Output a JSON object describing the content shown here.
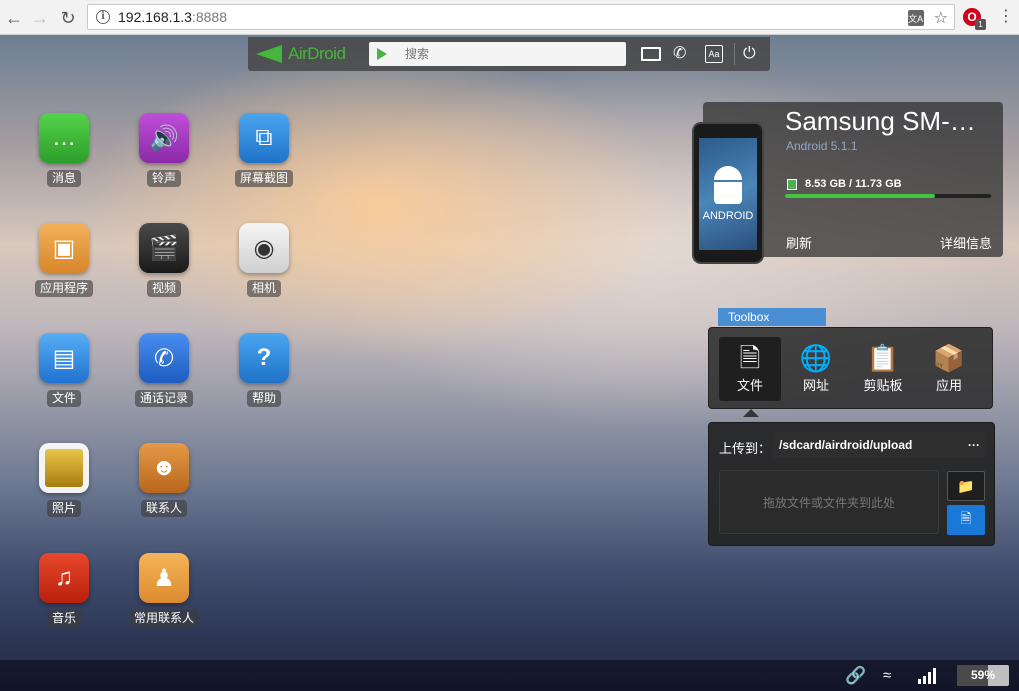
{
  "browser": {
    "url_host": "192.168.1.3",
    "url_port": ":8888",
    "info_icon": "i",
    "translate_icon": "文A",
    "opera_letter": "O",
    "opera_badge": "1"
  },
  "topbar": {
    "logo_text": "AirDroid",
    "search_placeholder": "搜索",
    "aa_label": "Aa"
  },
  "apps": [
    {
      "label": "消息",
      "icon": "message-icon",
      "color": "#3bb33b"
    },
    {
      "label": "铃声",
      "icon": "speaker-icon",
      "color": "#a23bc4"
    },
    {
      "label": "屏幕截图",
      "icon": "crop-icon",
      "color": "#2d8de0"
    },
    {
      "label": "应用程序",
      "icon": "package-icon",
      "color": "#e8953a"
    },
    {
      "label": "视频",
      "icon": "clapperboard-icon",
      "color": "#333333"
    },
    {
      "label": "相机",
      "icon": "camera-icon",
      "color": "#e6e6e6"
    },
    {
      "label": "文件",
      "icon": "folder-icon",
      "color": "#2f8be6"
    },
    {
      "label": "通话记录",
      "icon": "phone-icon",
      "color": "#2a6fd4"
    },
    {
      "label": "帮助",
      "icon": "help-icon",
      "color": "#2d8de0"
    },
    {
      "label": "照片",
      "icon": "photo-icon",
      "color": "#d8b020"
    },
    {
      "label": "联系人",
      "icon": "contact-book-icon",
      "color": "#d07a2a"
    },
    {
      "label": "音乐",
      "icon": "music-icon",
      "color": "#d8341e"
    },
    {
      "label": "常用联系人",
      "icon": "favorite-contacts-icon",
      "color": "#e89a3a"
    }
  ],
  "device": {
    "name": "Samsung SM-…",
    "android_version": "Android 5.1.1",
    "phone_text": "ANDROID",
    "storage_text": "8.53 GB / 11.73 GB",
    "storage_fraction": 0.727,
    "refresh_label": "刷新",
    "details_label": "详细信息"
  },
  "toolbox": {
    "tab_label": "Toolbox",
    "tools": [
      {
        "label": "文件",
        "icon": "file-icon",
        "active": true
      },
      {
        "label": "网址",
        "icon": "globe-icon",
        "active": false
      },
      {
        "label": "剪贴板",
        "icon": "clipboard-icon",
        "active": false
      },
      {
        "label": "应用",
        "icon": "app-box-icon",
        "active": false
      }
    ]
  },
  "upload": {
    "label": "上传到：",
    "path": "/sdcard/airdroid/upload",
    "more": "···",
    "drop_hint": "拖放文件或文件夹到此处"
  },
  "status": {
    "battery_text": "59%",
    "battery_level": 0.59
  }
}
